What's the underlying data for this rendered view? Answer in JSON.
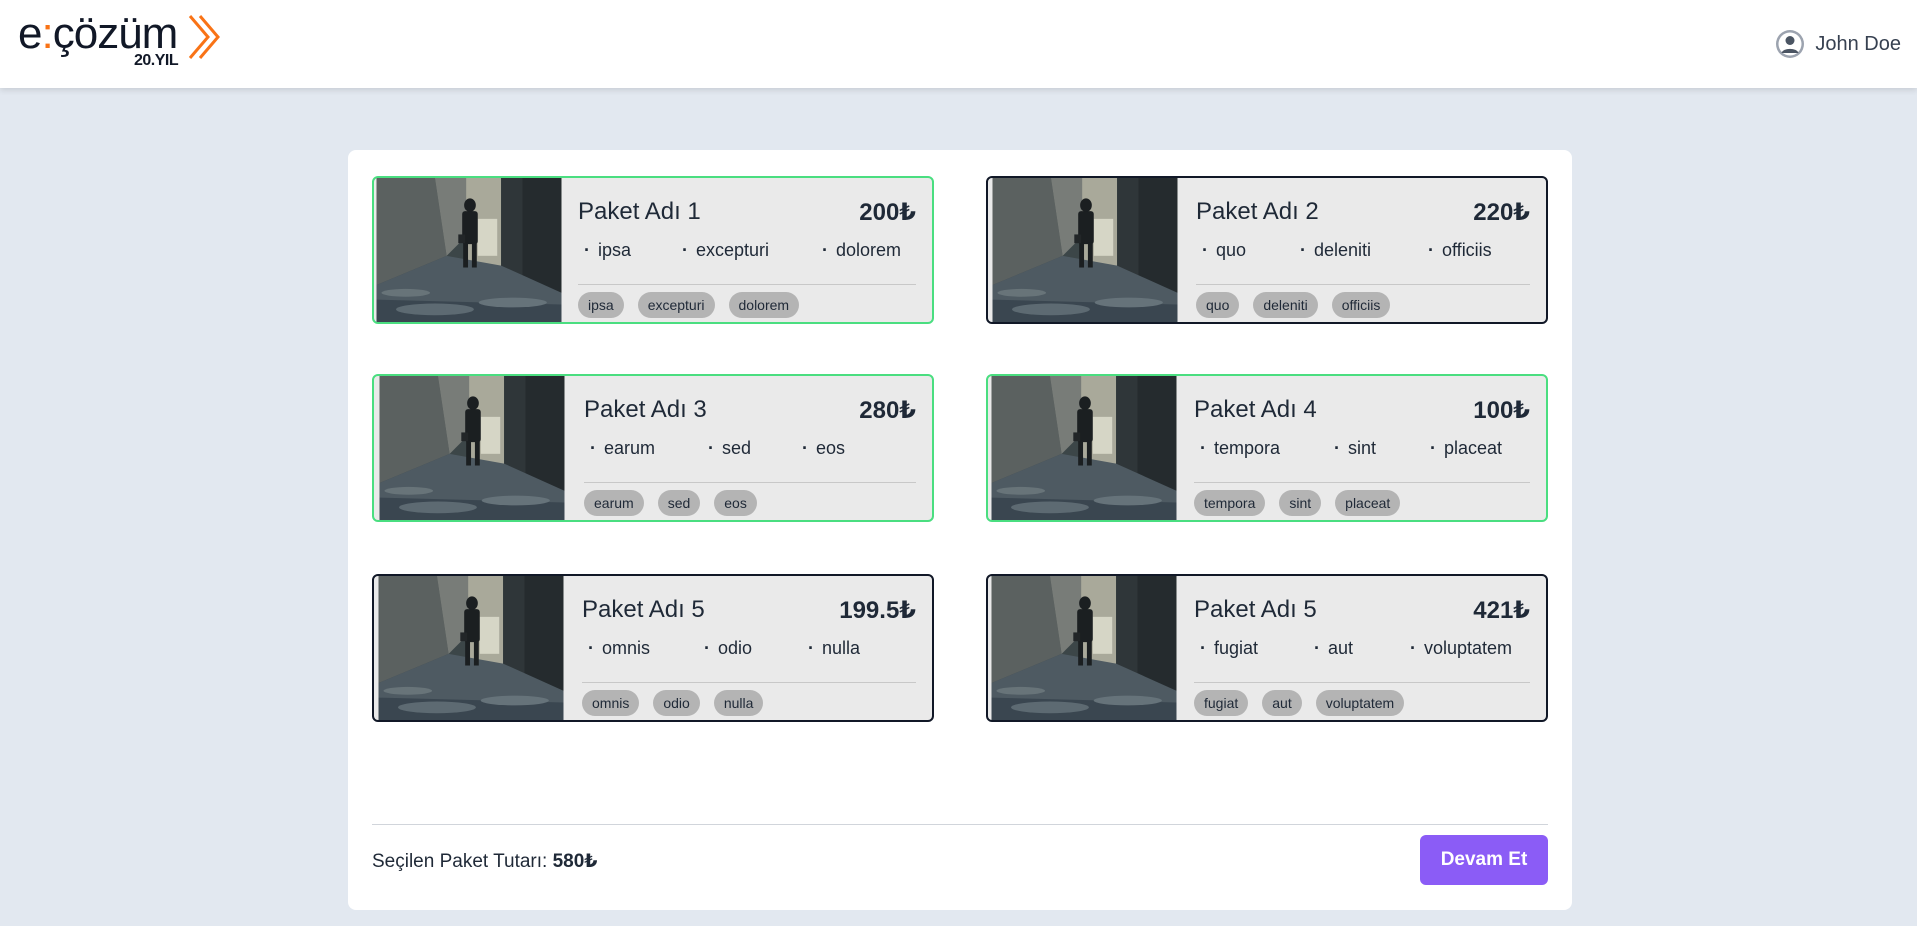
{
  "header": {
    "logo_main": "e:çözüm",
    "logo_colon": ":",
    "logo_sub": "20.YIL",
    "user_name": "John Doe"
  },
  "colors": {
    "selected_border": "#4ade80",
    "unselected_border": "#111827",
    "button": "#8b5cf6",
    "logo_accent": "#f97316"
  },
  "packages": [
    {
      "name": "Paket Adı 1",
      "price": "200₺",
      "selected": true,
      "features": [
        "ipsa",
        "excepturi",
        "dolorem"
      ],
      "tags": [
        "ipsa",
        "excepturi",
        "dolorem"
      ]
    },
    {
      "name": "Paket Adı 2",
      "price": "220₺",
      "selected": false,
      "features": [
        "quo",
        "deleniti",
        "officiis"
      ],
      "tags": [
        "quo",
        "deleniti",
        "officiis"
      ]
    },
    {
      "name": "Paket Adı 3",
      "price": "280₺",
      "selected": true,
      "features": [
        "earum",
        "sed",
        "eos"
      ],
      "tags": [
        "earum",
        "sed",
        "eos"
      ]
    },
    {
      "name": "Paket Adı 4",
      "price": "100₺",
      "selected": true,
      "features": [
        "tempora",
        "sint",
        "placeat"
      ],
      "tags": [
        "tempora",
        "sint",
        "placeat"
      ]
    },
    {
      "name": "Paket Adı 5",
      "price": "199.5₺",
      "selected": false,
      "features": [
        "omnis",
        "odio",
        "nulla"
      ],
      "tags": [
        "omnis",
        "odio",
        "nulla"
      ]
    },
    {
      "name": "Paket Adı 5",
      "price": "421₺",
      "selected": false,
      "features": [
        "fugiat",
        "aut",
        "voluptatem"
      ],
      "tags": [
        "fugiat",
        "aut",
        "voluptatem"
      ]
    }
  ],
  "footer": {
    "total_label": "Seçilen Paket Tutarı:",
    "total_value": "580₺",
    "continue_label": "Devam Et"
  }
}
